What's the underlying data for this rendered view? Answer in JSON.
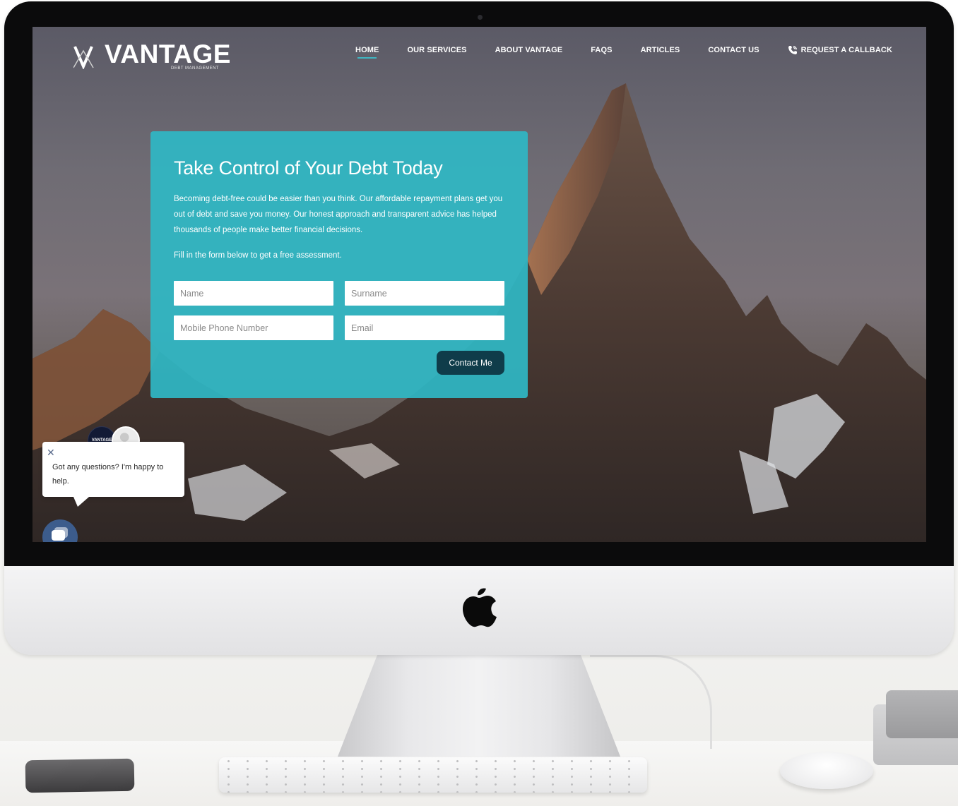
{
  "nav": {
    "logo_text": "VANTAGE",
    "logo_subtitle": "DEBT MANAGEMENT",
    "items": [
      {
        "label": "HOME",
        "active": true
      },
      {
        "label": "OUR SERVICES",
        "active": false
      },
      {
        "label": "ABOUT VANTAGE",
        "active": false
      },
      {
        "label": "FAQS",
        "active": false
      },
      {
        "label": "ARTICLES",
        "active": false
      },
      {
        "label": "CONTACT US",
        "active": false
      }
    ],
    "callback_label": "REQUEST A CALLBACK",
    "callback_icon": "phone-icon"
  },
  "hero": {
    "title": "Take Control of Your Debt Today",
    "description": "Becoming debt-free could be easier than you think. Our affordable repayment plans get you out of debt and save you money. Our honest approach and transparent advice has helped thousands of people make better financial decisions.",
    "cta_text": "Fill in the form below to get a free assessment.",
    "form": {
      "name_placeholder": "Name",
      "surname_placeholder": "Surname",
      "phone_placeholder": "Mobile Phone Number",
      "email_placeholder": "Email",
      "submit_label": "Contact Me"
    }
  },
  "chat": {
    "brand_avatar_text": "VANTAGE",
    "message": "Got any questions? I'm happy to help.",
    "close_icon": "close-icon",
    "launcher_icon": "chat-icon"
  },
  "colors": {
    "accent": "#2fb7c4",
    "button": "#0f3c4a",
    "chat_launcher": "#3c5c8c"
  }
}
